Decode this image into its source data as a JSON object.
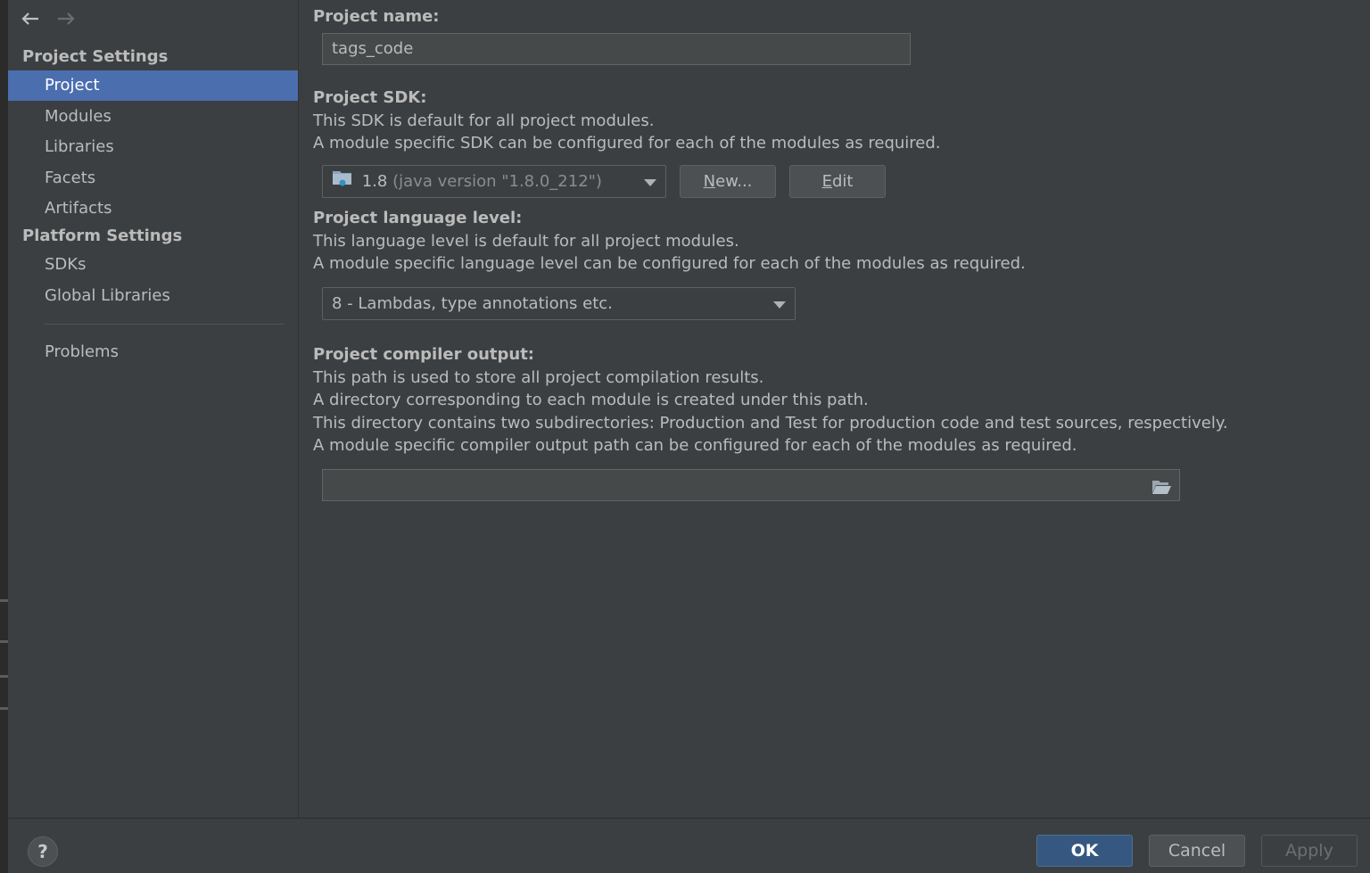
{
  "sidebar": {
    "project_settings_header": "Project Settings",
    "project_items": [
      {
        "label": "Project",
        "selected": true
      },
      {
        "label": "Modules"
      },
      {
        "label": "Libraries"
      },
      {
        "label": "Facets"
      },
      {
        "label": "Artifacts"
      }
    ],
    "platform_settings_header": "Platform Settings",
    "platform_items": [
      {
        "label": "SDKs"
      },
      {
        "label": "Global Libraries"
      }
    ],
    "problems_label": "Problems"
  },
  "main": {
    "project_name": {
      "label": "Project name:",
      "value": "tags_code"
    },
    "project_sdk": {
      "label": "Project SDK:",
      "desc1": "This SDK is default for all project modules.",
      "desc2": "A module specific SDK can be configured for each of the modules as required.",
      "selected_version": "1.8",
      "selected_detail": "(java version \"1.8.0_212\")",
      "new_button_accel": "N",
      "new_button_rest": "ew...",
      "edit_button_accel": "E",
      "edit_button_rest": "dit"
    },
    "language_level": {
      "label": "Project language level:",
      "desc1": "This language level is default for all project modules.",
      "desc2": "A module specific language level can be configured for each of the modules as required.",
      "selected": "8 - Lambdas, type annotations etc."
    },
    "compiler_output": {
      "label": "Project compiler output:",
      "desc1": "This path is used to store all project compilation results.",
      "desc2": "A directory corresponding to each module is created under this path.",
      "desc3": "This directory contains two subdirectories: Production and Test for production code and test sources, respectively.",
      "desc4": "A module specific compiler output path can be configured for each of the modules as required.",
      "value": ""
    }
  },
  "footer": {
    "help_label": "?",
    "ok_label": "OK",
    "cancel_label": "Cancel",
    "apply_label": "Apply"
  },
  "colors": {
    "background": "#3c3f41",
    "selection": "#4b6eaf",
    "ok_button": "#365880",
    "text": "#bbbbbb"
  }
}
